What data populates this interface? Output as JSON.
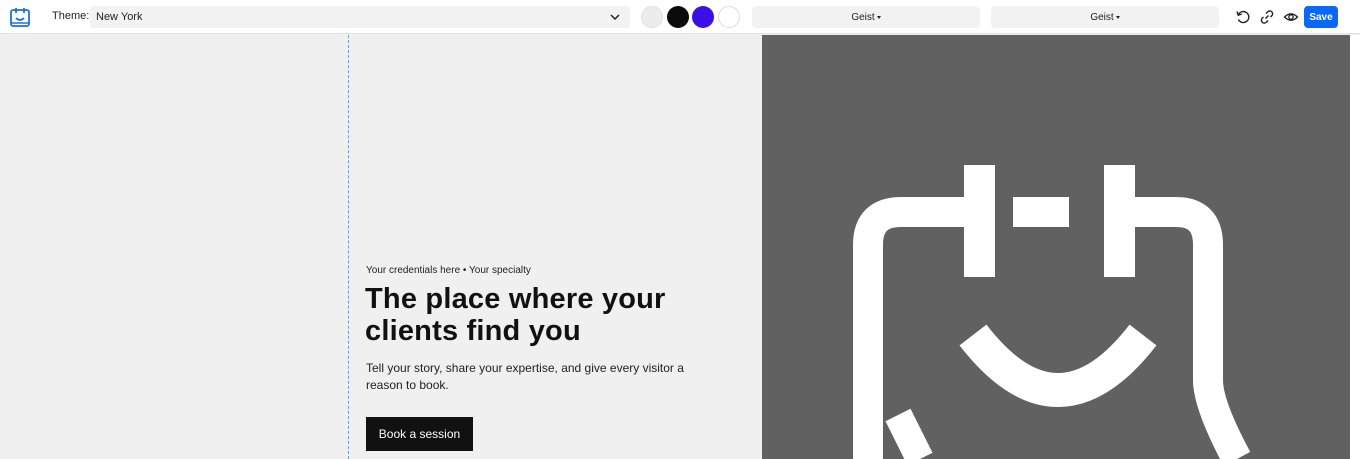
{
  "toolbar": {
    "theme_label": "Theme:",
    "theme_value": "New York",
    "swatch_colors": [
      "#ececec",
      "#0b0b0b",
      "#3a10e5",
      "#ffffff"
    ],
    "heading_font": "Geist",
    "body_font": "Geist",
    "icons": [
      "calendar-logo-icon",
      "chevron-down-icon",
      "reset-icon",
      "link-icon",
      "eye-icon"
    ],
    "save_label": "Save",
    "accent_color": "#0b67f5"
  },
  "hero": {
    "credentials": "Your credentials here • Your specialty",
    "headline": "The place where your clients find you",
    "subtext": "Tell your story, share your expertise, and give every visitor a reason to book.",
    "cta_label": "Book a session"
  }
}
